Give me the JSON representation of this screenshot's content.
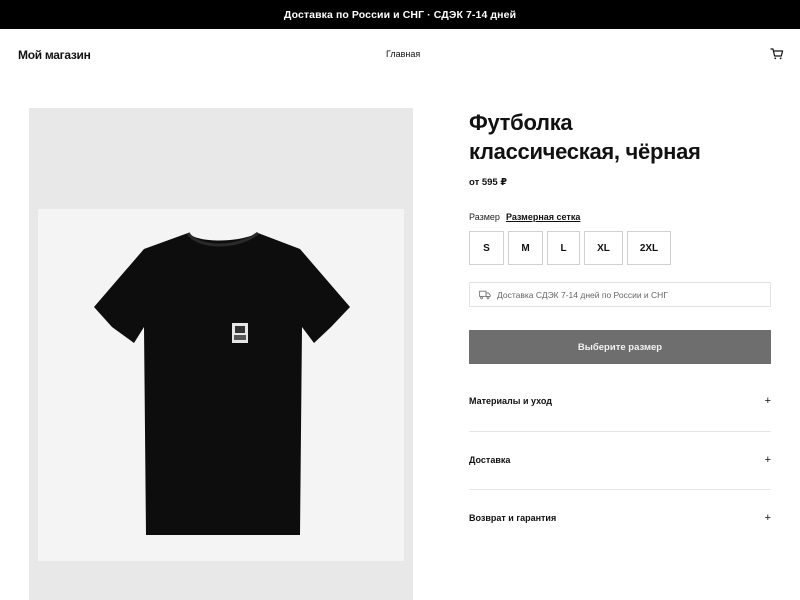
{
  "announcement": "Доставка по России и СНГ · СДЭК 7-14 дней",
  "header": {
    "logo": "Мой магазин",
    "nav_home": "Главная",
    "cart_icon": "cart-icon"
  },
  "product": {
    "title_line1": "Футболка",
    "title_line2": "классическая, чёрная",
    "price": "от 595 ₽",
    "size_label": "Размер",
    "size_chart": "Размерная сетка",
    "sizes": [
      "S",
      "M",
      "L",
      "XL",
      "2XL"
    ],
    "delivery_note": "Доставка СДЭК 7-14 дней по России и СНГ",
    "cta": "Выберите размер",
    "accordions": [
      {
        "label": "Материалы и уход",
        "icon": "+"
      },
      {
        "label": "Доставка",
        "icon": "+"
      },
      {
        "label": "Возврат и гарантия",
        "icon": "+"
      }
    ]
  },
  "colors": {
    "announcement_bg": "#000000",
    "cta_bg": "#6e6e6e",
    "gallery_bg": "#e8e8e8"
  }
}
